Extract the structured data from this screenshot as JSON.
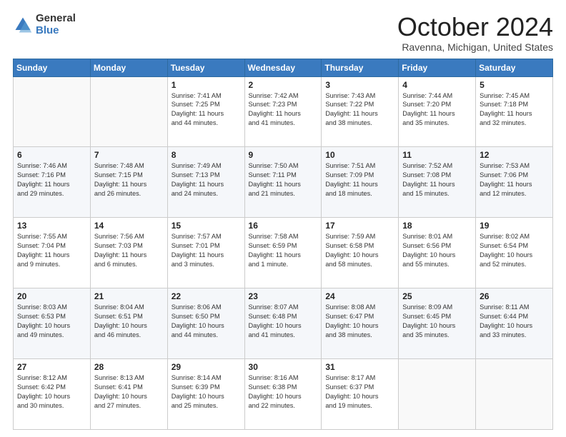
{
  "logo": {
    "general": "General",
    "blue": "Blue"
  },
  "title": "October 2024",
  "location": "Ravenna, Michigan, United States",
  "days_of_week": [
    "Sunday",
    "Monday",
    "Tuesday",
    "Wednesday",
    "Thursday",
    "Friday",
    "Saturday"
  ],
  "weeks": [
    [
      {
        "day": "",
        "info": ""
      },
      {
        "day": "",
        "info": ""
      },
      {
        "day": "1",
        "info": "Sunrise: 7:41 AM\nSunset: 7:25 PM\nDaylight: 11 hours\nand 44 minutes."
      },
      {
        "day": "2",
        "info": "Sunrise: 7:42 AM\nSunset: 7:23 PM\nDaylight: 11 hours\nand 41 minutes."
      },
      {
        "day": "3",
        "info": "Sunrise: 7:43 AM\nSunset: 7:22 PM\nDaylight: 11 hours\nand 38 minutes."
      },
      {
        "day": "4",
        "info": "Sunrise: 7:44 AM\nSunset: 7:20 PM\nDaylight: 11 hours\nand 35 minutes."
      },
      {
        "day": "5",
        "info": "Sunrise: 7:45 AM\nSunset: 7:18 PM\nDaylight: 11 hours\nand 32 minutes."
      }
    ],
    [
      {
        "day": "6",
        "info": "Sunrise: 7:46 AM\nSunset: 7:16 PM\nDaylight: 11 hours\nand 29 minutes."
      },
      {
        "day": "7",
        "info": "Sunrise: 7:48 AM\nSunset: 7:15 PM\nDaylight: 11 hours\nand 26 minutes."
      },
      {
        "day": "8",
        "info": "Sunrise: 7:49 AM\nSunset: 7:13 PM\nDaylight: 11 hours\nand 24 minutes."
      },
      {
        "day": "9",
        "info": "Sunrise: 7:50 AM\nSunset: 7:11 PM\nDaylight: 11 hours\nand 21 minutes."
      },
      {
        "day": "10",
        "info": "Sunrise: 7:51 AM\nSunset: 7:09 PM\nDaylight: 11 hours\nand 18 minutes."
      },
      {
        "day": "11",
        "info": "Sunrise: 7:52 AM\nSunset: 7:08 PM\nDaylight: 11 hours\nand 15 minutes."
      },
      {
        "day": "12",
        "info": "Sunrise: 7:53 AM\nSunset: 7:06 PM\nDaylight: 11 hours\nand 12 minutes."
      }
    ],
    [
      {
        "day": "13",
        "info": "Sunrise: 7:55 AM\nSunset: 7:04 PM\nDaylight: 11 hours\nand 9 minutes."
      },
      {
        "day": "14",
        "info": "Sunrise: 7:56 AM\nSunset: 7:03 PM\nDaylight: 11 hours\nand 6 minutes."
      },
      {
        "day": "15",
        "info": "Sunrise: 7:57 AM\nSunset: 7:01 PM\nDaylight: 11 hours\nand 3 minutes."
      },
      {
        "day": "16",
        "info": "Sunrise: 7:58 AM\nSunset: 6:59 PM\nDaylight: 11 hours\nand 1 minute."
      },
      {
        "day": "17",
        "info": "Sunrise: 7:59 AM\nSunset: 6:58 PM\nDaylight: 10 hours\nand 58 minutes."
      },
      {
        "day": "18",
        "info": "Sunrise: 8:01 AM\nSunset: 6:56 PM\nDaylight: 10 hours\nand 55 minutes."
      },
      {
        "day": "19",
        "info": "Sunrise: 8:02 AM\nSunset: 6:54 PM\nDaylight: 10 hours\nand 52 minutes."
      }
    ],
    [
      {
        "day": "20",
        "info": "Sunrise: 8:03 AM\nSunset: 6:53 PM\nDaylight: 10 hours\nand 49 minutes."
      },
      {
        "day": "21",
        "info": "Sunrise: 8:04 AM\nSunset: 6:51 PM\nDaylight: 10 hours\nand 46 minutes."
      },
      {
        "day": "22",
        "info": "Sunrise: 8:06 AM\nSunset: 6:50 PM\nDaylight: 10 hours\nand 44 minutes."
      },
      {
        "day": "23",
        "info": "Sunrise: 8:07 AM\nSunset: 6:48 PM\nDaylight: 10 hours\nand 41 minutes."
      },
      {
        "day": "24",
        "info": "Sunrise: 8:08 AM\nSunset: 6:47 PM\nDaylight: 10 hours\nand 38 minutes."
      },
      {
        "day": "25",
        "info": "Sunrise: 8:09 AM\nSunset: 6:45 PM\nDaylight: 10 hours\nand 35 minutes."
      },
      {
        "day": "26",
        "info": "Sunrise: 8:11 AM\nSunset: 6:44 PM\nDaylight: 10 hours\nand 33 minutes."
      }
    ],
    [
      {
        "day": "27",
        "info": "Sunrise: 8:12 AM\nSunset: 6:42 PM\nDaylight: 10 hours\nand 30 minutes."
      },
      {
        "day": "28",
        "info": "Sunrise: 8:13 AM\nSunset: 6:41 PM\nDaylight: 10 hours\nand 27 minutes."
      },
      {
        "day": "29",
        "info": "Sunrise: 8:14 AM\nSunset: 6:39 PM\nDaylight: 10 hours\nand 25 minutes."
      },
      {
        "day": "30",
        "info": "Sunrise: 8:16 AM\nSunset: 6:38 PM\nDaylight: 10 hours\nand 22 minutes."
      },
      {
        "day": "31",
        "info": "Sunrise: 8:17 AM\nSunset: 6:37 PM\nDaylight: 10 hours\nand 19 minutes."
      },
      {
        "day": "",
        "info": ""
      },
      {
        "day": "",
        "info": ""
      }
    ]
  ]
}
